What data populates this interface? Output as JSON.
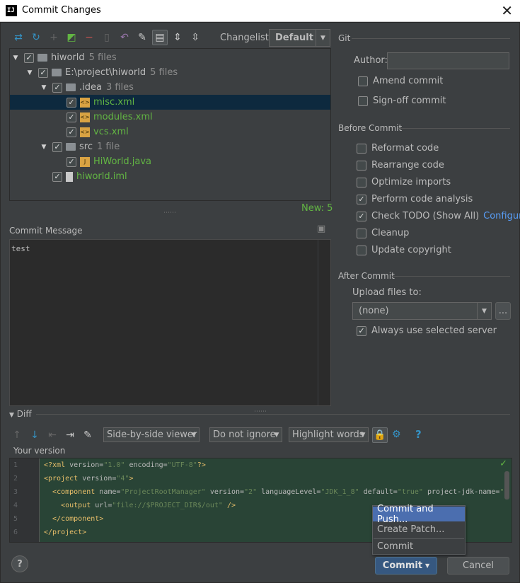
{
  "window": {
    "title": "Commit Changes"
  },
  "toolbar": {
    "icons": [
      "refresh-changes-icon",
      "rollback-icon",
      "add-icon",
      "move-to-changelist-icon",
      "remove-icon",
      "jump-to-source-icon",
      "revert-icon",
      "edit-icon",
      "group-by-directory-icon",
      "expand-all-icon",
      "collapse-all-icon"
    ],
    "changelist_label": "Changelist:",
    "changelist_value": "Default"
  },
  "tree": {
    "rows": [
      {
        "name": "hiworld",
        "count": "5 files"
      },
      {
        "name": "E:\\project\\hiworld",
        "count": "5 files"
      },
      {
        "name": ".idea",
        "count": "3 files"
      },
      {
        "name": "misc.xml"
      },
      {
        "name": "modules.xml"
      },
      {
        "name": "vcs.xml"
      },
      {
        "name": "src",
        "count": "1 file"
      },
      {
        "name": "HiWorld.java"
      },
      {
        "name": "hiworld.iml"
      }
    ],
    "status": "New: 5"
  },
  "commit_message": {
    "label": "Commit Message",
    "text": "test"
  },
  "git": {
    "title": "Git",
    "author_label": "Author:",
    "author_value": "",
    "amend_commit": "Amend commit",
    "signoff_commit": "Sign-off commit"
  },
  "before_commit": {
    "title": "Before Commit",
    "reformat": "Reformat code",
    "rearrange": "Rearrange code",
    "optimize": "Optimize imports",
    "perform_analysis": "Perform code analysis",
    "check_todo": "Check TODO (Show All)",
    "configure": "Configure",
    "cleanup": "Cleanup",
    "update_copyright": "Update copyright"
  },
  "after_commit": {
    "title": "After Commit",
    "upload_label": "Upload files to:",
    "upload_value": "(none)",
    "more": "...",
    "always_use": "Always use selected server"
  },
  "diff": {
    "title": "Diff",
    "viewer": "Side-by-side viewer",
    "ignore": "Do not ignore",
    "highlight": "Highlight words",
    "your_version": "Your version",
    "line_numbers": [
      "1",
      "2",
      "3",
      "4",
      "5",
      "6"
    ]
  },
  "popup": {
    "commit_push": "Commit and Push...",
    "create_patch": "Create Patch...",
    "commit": "Commit"
  },
  "buttons": {
    "commit": "Commit",
    "cancel": "Cancel",
    "help": "?"
  },
  "colors": {
    "background": "#3c3f41",
    "selection": "#0d293e",
    "accent": "#4b6eaf",
    "new_file": "#62b543",
    "link": "#589df6"
  }
}
